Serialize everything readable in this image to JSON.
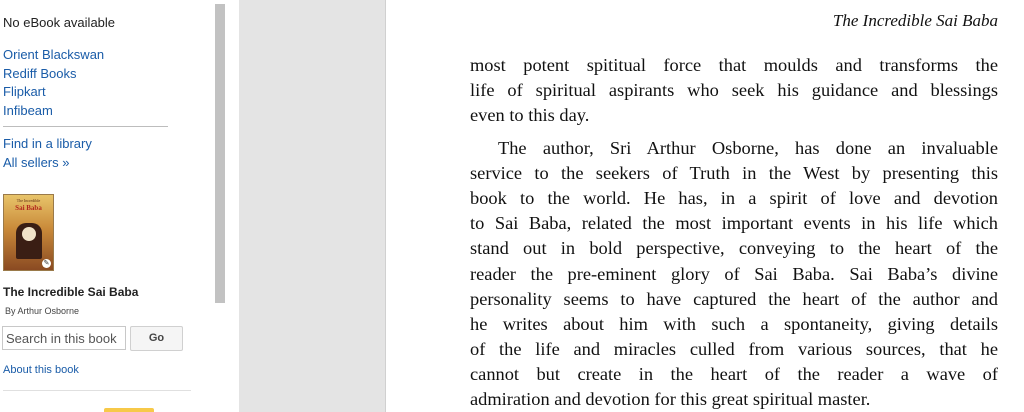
{
  "sidebar": {
    "no_ebook": "No eBook available",
    "sellers": [
      "Orient Blackswan",
      "Rediff Books",
      "Flipkart",
      "Infibeam"
    ],
    "find_library": "Find in a library",
    "all_sellers": "All sellers »",
    "cover": {
      "top_text": "The Incredible",
      "big_text": "Sai Baba"
    },
    "book_title": "The Incredible Sai Baba",
    "book_author": "By Arthur Osborne",
    "search": {
      "placeholder": "Search in this book",
      "button": "Go"
    },
    "about": "About this book"
  },
  "page": {
    "running_head": "The Incredible Sai Baba",
    "paragraph1": [
      "most potent spititual force that moulds and transforms  the",
      "life of spiritual aspirants who seek his guidance and  blessings",
      "even to this day."
    ],
    "paragraph2": [
      "The author, Sri Arthur Osborne, has done an invaluable",
      "service to the seekers of Truth in the West by presenting  this",
      "book to the world. He has, in a spirit of love and devotion",
      "to Sai Baba, related the most important events in his life which",
      "stand out in bold perspective, conveying to the heart of the",
      "reader the pre-eminent glory of Sai Baba. Sai Baba’s divine",
      "personality seems to have captured the heart of the author and",
      "he writes about him with such a spontaneity, giving details",
      "of the life and miracles culled from various sources, that he",
      "cannot but create in the heart of the reader a wave of",
      "admiration and devotion for this great spiritual master."
    ]
  },
  "colors": {
    "link": "#1a5ca8",
    "gutter": "#e4e4e4"
  }
}
